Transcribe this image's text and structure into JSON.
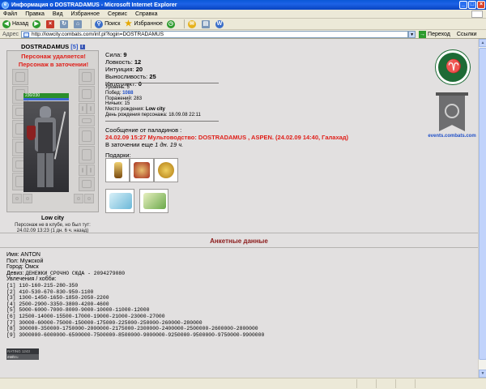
{
  "window": {
    "title": "Информация о DOSTRADAMUS - Microsoft Internet Explorer"
  },
  "menu": [
    "Файл",
    "Правка",
    "Вид",
    "Избранное",
    "Сервис",
    "Справка"
  ],
  "toolbar": {
    "back": "Назад",
    "search": "Поиск",
    "favorites": "Избранное"
  },
  "address": {
    "label": "Адрес",
    "url": "http://lowcity.combats.com/inf.pl?login=DOSTRADAMUS",
    "go": "Переход",
    "links": "Ссылки"
  },
  "character": {
    "name": "DOSTRADAMUS",
    "level": "[5]",
    "info_icon": "i",
    "warning1": "Персонаж удаляется!",
    "warning2": "Персонаж в заточении!",
    "hp": "230/230",
    "location": "Low city",
    "online_line1": "Персонаж не в клубе, но был тут:",
    "online_line2": "24.02.09 13:23 (1 дн. 6 ч. назад)"
  },
  "stats": [
    {
      "label": "Сила:",
      "value": "9"
    },
    {
      "label": "Ловкость:",
      "value": "12"
    },
    {
      "label": "Интуиция:",
      "value": "20"
    },
    {
      "label": "Выносливость:",
      "value": "25"
    },
    {
      "label": "Интеллект:",
      "value": "0"
    }
  ],
  "info": {
    "level_label": "Уровень:",
    "level": "5",
    "wins_label": "Побед:",
    "wins": "1088",
    "losses_label": "Поражений:",
    "losses": "283",
    "draws_label": "Ничьих:",
    "draws": "15",
    "birthplace_label": "Место рождения:",
    "birthplace": "Low city",
    "birthday_label": "День рождения персонажа:",
    "birthday": "18.09.08 22:11"
  },
  "message": {
    "label": "Сообщение от паладинов :",
    "text": "24.02.09 15:27 Мультоводство: DOSTRADAMUS , ASPEN. (24.02.09 14:40, Галахад)",
    "jail_prefix": "В заточении еще",
    "jail_time": "1 дн. 19 ч."
  },
  "gifts_label": "Подарки:",
  "events_label": "events.combats.com",
  "questionnaire": {
    "title": "Анкетные данные",
    "name": "Имя: ANTON",
    "gender": "Пол: Мужской",
    "city": "Город: Омск",
    "motto_label": "Девиз:",
    "motto": "ДЕНЕЖКИ СРОЧНО СЮДА - 2094279080",
    "hobbies_label": "Увлечения / хобби:",
    "hobbies": [
      "[1]  110-160-215-280-350",
      "[2]  410-530-670-830-950-1100",
      "[3]  1300-1450-1650-1850-2050-2200",
      "[4]  2500-2900-3350-3800-4200-4600",
      "[5]  5000-6000-7000-8000-9000-10000-11000-12000",
      "[6]  12500-14000-15500-17000-19000-21000-23000-27000",
      "[7]  30000-60000-75000-150000-175000-225000-250000-260000-280000",
      "[8]  300000-350000-1750000-2000000-2175000-2300000-2400000-2500000-2600000-2800000",
      "[9]  3000000-6000000-6500000-7500000-8500000-9000000-9250000-9500000-9750000-9900000"
    ]
  },
  "counter": {
    "line1": "RATING 1243 4676",
    "line2": "mail.ru"
  }
}
